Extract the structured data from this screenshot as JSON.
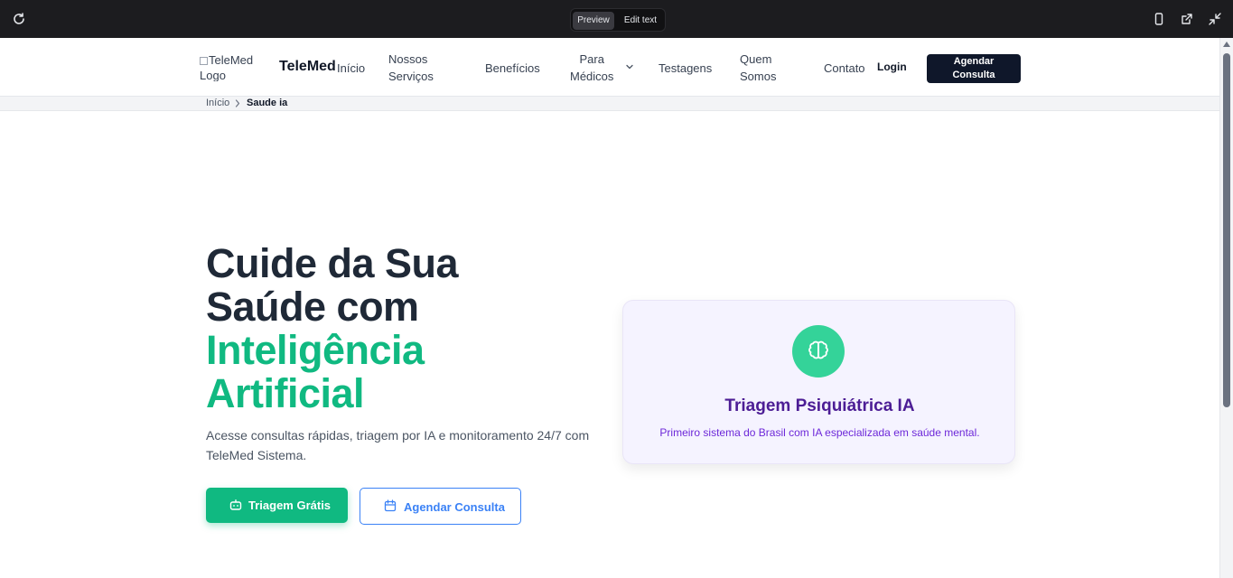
{
  "toolbar": {
    "preview_label": "Preview",
    "edit_label": "Edit text"
  },
  "nav": {
    "logo_alt": "TeleMed Logo",
    "brand": "TeleMed",
    "links": {
      "inicio": "Início",
      "servicos_1": "Nossos",
      "servicos_2": "Serviços",
      "beneficios": "Benefícios",
      "medicos_1": "Para",
      "medicos_2": "Médicos",
      "testagens": "Testagens",
      "quem_1": "Quem",
      "quem_2": "Somos",
      "contato": "Contato"
    },
    "login": "Login",
    "cta_1": "Agendar",
    "cta_2": "Consulta"
  },
  "breadcrumb": {
    "home": "Início",
    "current": "Saude ia"
  },
  "hero": {
    "title_line1": "Cuide da Sua",
    "title_line2": "Saúde com",
    "title_line3": "Inteligência",
    "title_line4": "Artificial",
    "lead": "Acesse consultas rápidas, triagem por IA e monitoramento 24/7 com TeleMed Sistema.",
    "btn_primary": "Triagem Grátis",
    "btn_secondary": "Agendar Consulta"
  },
  "card": {
    "icon": "brain-icon",
    "title": "Triagem Psiquiátrica IA",
    "subtitle": "Primeiro sistema do Brasil com IA especializada em saúde mental."
  },
  "colors": {
    "accent_green": "#10b981",
    "accent_blue": "#3b82f6",
    "navy": "#0f172a",
    "purple": "#4c1d95"
  }
}
